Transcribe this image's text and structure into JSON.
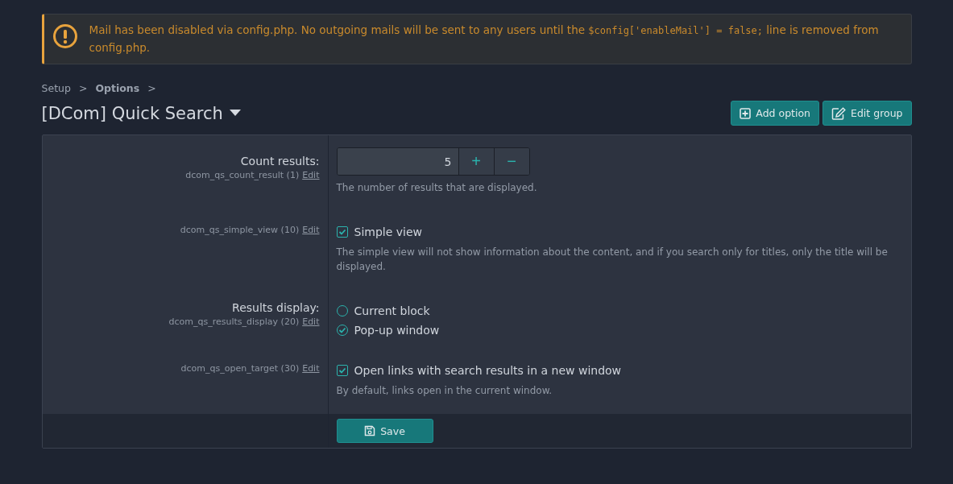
{
  "notice": {
    "parts": [
      {
        "kind": "text",
        "text": "Mail has been disabled via config.php. No outgoing mails will be sent to any users until the "
      },
      {
        "kind": "code",
        "text": "$config['enableMail'] = false;"
      },
      {
        "kind": "text",
        "text": " line is removed from config.php."
      }
    ]
  },
  "breadcrumb": [
    {
      "label": "Setup",
      "current": false
    },
    {
      "label": "Options",
      "current": true
    }
  ],
  "breadcrumb_separator": ">",
  "title": "[DCom] Quick Search",
  "actions": [
    {
      "kind": "add",
      "label": "Add option"
    },
    {
      "kind": "edit",
      "label": "Edit group"
    }
  ],
  "options": [
    {
      "kind": "number",
      "label": "Count results:",
      "key": "dcom_qs_count_result (1)",
      "edit": "Edit",
      "value": "5",
      "plus": "+",
      "minus": "−",
      "hint": "The number of results that are displayed."
    },
    {
      "kind": "checkbox",
      "key": "dcom_qs_simple_view (10)",
      "edit": "Edit",
      "choices": [
        {
          "label": "Simple view",
          "checked": true
        }
      ],
      "hint": "The simple view will not show information about the content, and if you search only for titles, only the title will be displayed."
    },
    {
      "kind": "radio",
      "label": "Results display:",
      "key": "dcom_qs_results_display (20)",
      "edit": "Edit",
      "choices": [
        {
          "label": "Current block",
          "selected": false
        },
        {
          "label": "Pop-up window",
          "selected": true
        }
      ]
    },
    {
      "kind": "checkbox",
      "key": "dcom_qs_open_target (30)",
      "edit": "Edit",
      "choices": [
        {
          "label": "Open links with search results in a new window",
          "checked": true
        }
      ],
      "hint": "By default, links open in the current window."
    }
  ],
  "save": "Save"
}
